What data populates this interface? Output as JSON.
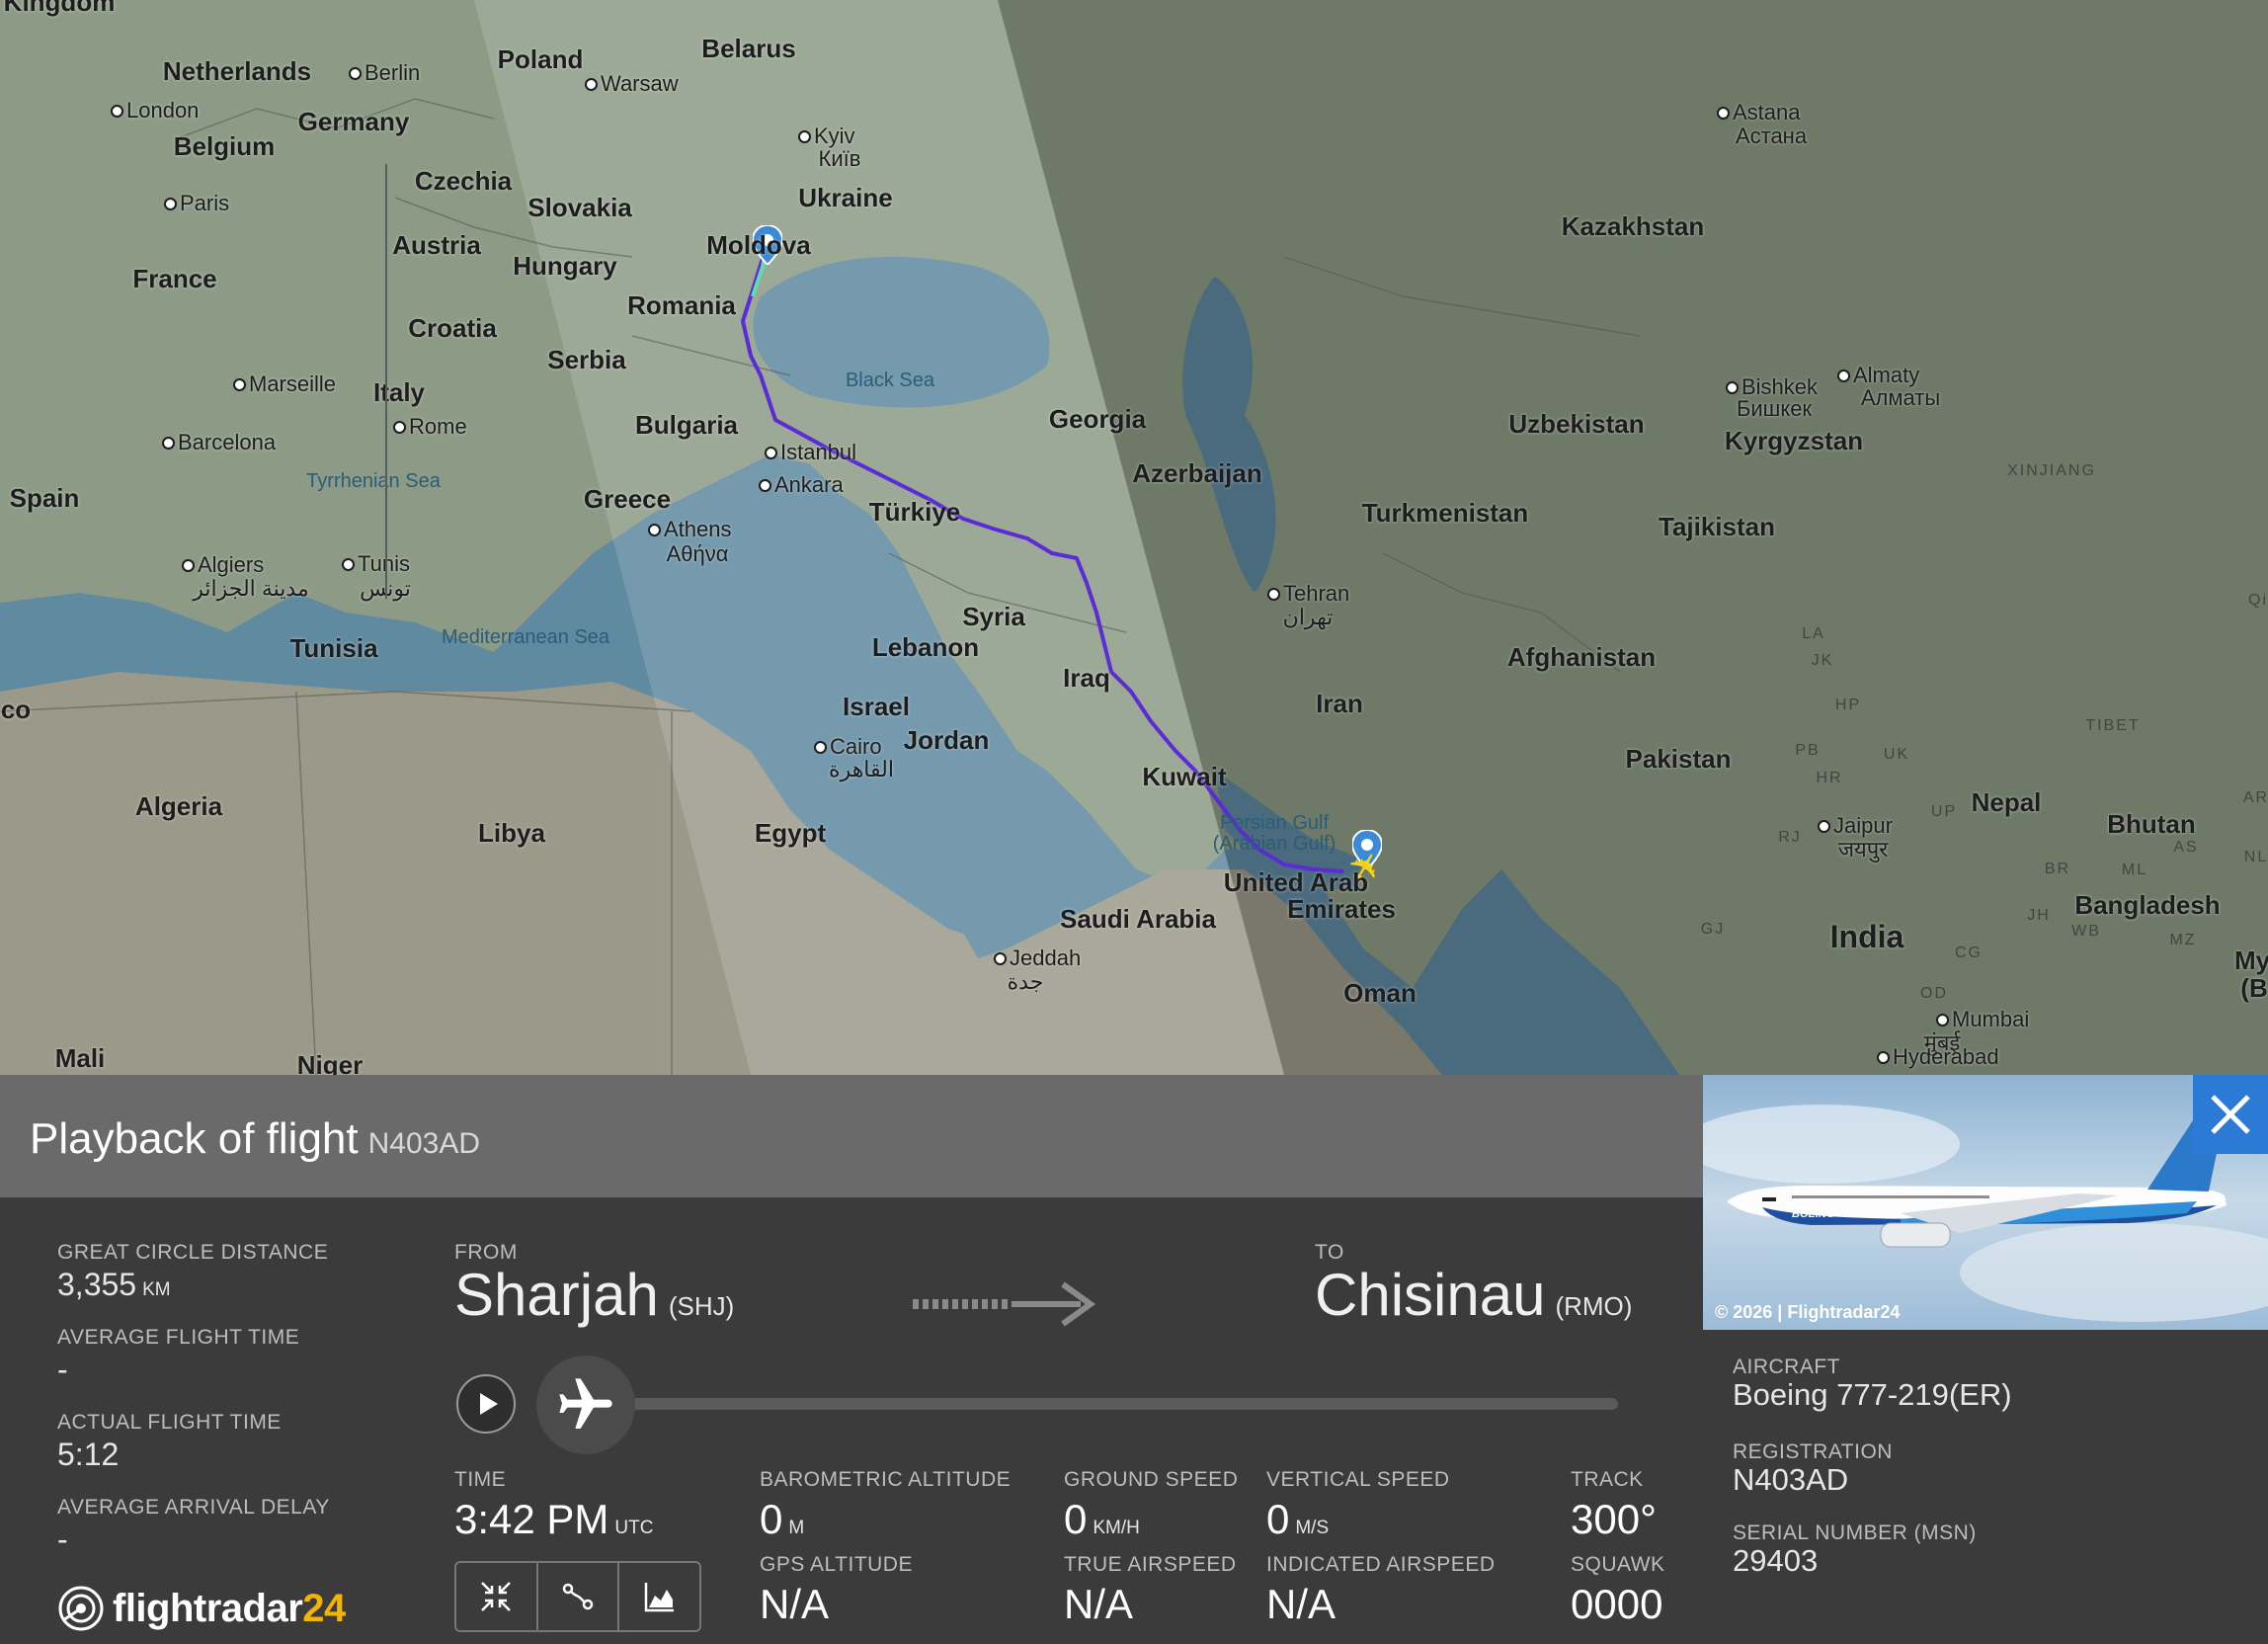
{
  "map": {
    "countries": [
      "Netherlands",
      "Germany",
      "Belgium",
      "Poland",
      "Belarus",
      "Czechia",
      "Slovakia",
      "Ukraine",
      "France",
      "Austria",
      "Hungary",
      "Moldova",
      "Romania",
      "Croatia",
      "Serbia",
      "Italy",
      "Bulgaria",
      "Spain",
      "Greece",
      "Türkiye",
      "Georgia",
      "Azerbaijan",
      "Kazakhstan",
      "Uzbekistan",
      "Kyrgyzstan",
      "Turkmenistan",
      "Tajikistan",
      "Syria",
      "Lebanon",
      "Iraq",
      "Iran",
      "Afghanistan",
      "Israel",
      "Jordan",
      "Kuwait",
      "Pakistan",
      "Nepal",
      "Bhutan",
      "Bangladesh",
      "India",
      "Tunisia",
      "Algeria",
      "Libya",
      "Egypt",
      "Saudi Arabia",
      "Oman",
      "Mali",
      "Niger"
    ],
    "uae_label": [
      "United Arab",
      "Emirates"
    ],
    "cities": [
      "Berlin",
      "London",
      "Warsaw",
      "Kyiv",
      "Київ",
      "Paris",
      "Marseille",
      "Rome",
      "Barcelona",
      "Istanbul",
      "Ankara",
      "Athens",
      "Αθήνα",
      "Algiers",
      "مدينة الجزائر",
      "Tunis",
      "تونس",
      "Tehran",
      "تهران",
      "Cairo",
      "القاهرة",
      "Jeddah",
      "جدة",
      "Astana",
      "Астана",
      "Bishkek",
      "Бишкек",
      "Almaty",
      "Алматы",
      "Jaipur",
      "जयपुर",
      "Mumbai",
      "मुंबई",
      "Hyderabad"
    ],
    "seas": [
      "Black Sea",
      "Tyrrhenian Sea",
      "Mediterranean Sea",
      "Persian Gulf",
      "(Arabian Gulf)"
    ],
    "regions": [
      "XINJIANG",
      "TIBET",
      "LA",
      "JK",
      "HP",
      "PB",
      "HR",
      "UK",
      "UP",
      "RJ",
      "GJ",
      "CG",
      "OD",
      "MZ",
      "WB",
      "BR",
      "JH",
      "AS",
      "ML",
      "NL",
      "AR"
    ],
    "edge_labels": [
      "Kingdom",
      "co",
      "Qi",
      "My",
      "(B"
    ],
    "route_color": "#5b2bd6",
    "origin_pin_color": "#3a8ad6",
    "plane_color": "#f2d41c"
  },
  "panel": {
    "title": "Playback of flight",
    "flight_reg": "N403AD",
    "stats": [
      {
        "label": "GREAT CIRCLE DISTANCE",
        "value": "3,355",
        "unit": "KM"
      },
      {
        "label": "AVERAGE FLIGHT TIME",
        "value": "-",
        "unit": ""
      },
      {
        "label": "ACTUAL FLIGHT TIME",
        "value": "5:12",
        "unit": ""
      },
      {
        "label": "AVERAGE ARRIVAL DELAY",
        "value": "-",
        "unit": ""
      }
    ],
    "from": {
      "label": "FROM",
      "city": "Sharjah",
      "code": "(SHJ)"
    },
    "to": {
      "label": "TO",
      "city": "Chisinau",
      "code": "(RMO)"
    },
    "playback_progress": 0,
    "telemetry_top": [
      {
        "label": "TIME",
        "value": "3:42 PM",
        "unit": "UTC"
      },
      {
        "label": "BAROMETRIC ALTITUDE",
        "value": "0",
        "unit": "M"
      },
      {
        "label": "GROUND SPEED",
        "value": "0",
        "unit": "KM/H"
      },
      {
        "label": "VERTICAL SPEED",
        "value": "0",
        "unit": "M/S"
      },
      {
        "label": "TRACK",
        "value": "300°",
        "unit": ""
      }
    ],
    "telemetry_bottom": [
      {
        "label": "GPS ALTITUDE",
        "value": "N/A"
      },
      {
        "label": "TRUE AIRSPEED",
        "value": "N/A"
      },
      {
        "label": "INDICATED AIRSPEED",
        "value": "N/A"
      },
      {
        "label": "SQUAWK",
        "value": "0000"
      }
    ],
    "tools": [
      "collapse-icon",
      "route-icon",
      "chart-icon"
    ],
    "logo_text": "flightradar",
    "logo_num": "24"
  },
  "card": {
    "copyright": "© 2026 | Flightradar24",
    "aircraft_label": "AIRCRAFT",
    "aircraft": "Boeing 777-219(ER)",
    "registration_label": "REGISTRATION",
    "registration": "N403AD",
    "serial_label": "SERIAL NUMBER (MSN)",
    "serial": "29403",
    "close_color": "#2a7ad6"
  }
}
